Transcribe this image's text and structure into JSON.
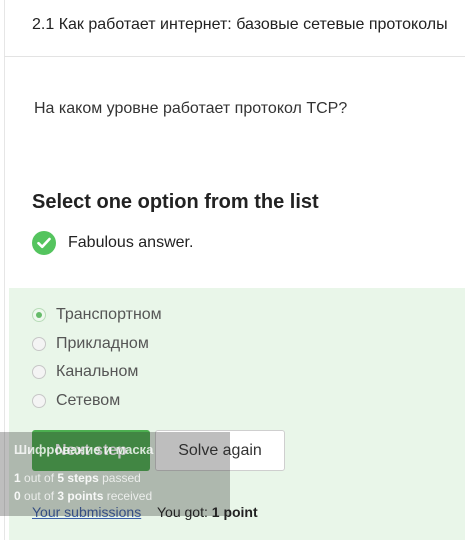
{
  "lesson": {
    "title": "2.1 Как работает интернет: базовые сетевые протоколы"
  },
  "question": {
    "text": "На каком уровне работает протокол TCP?"
  },
  "prompt": {
    "heading": "Select one option from the list"
  },
  "feedback": {
    "text": "Fabulous answer.",
    "icon": "check-circle-icon",
    "color": "#54c45e"
  },
  "options": [
    {
      "label": "Транспортном",
      "selected": true
    },
    {
      "label": "Прикладном",
      "selected": false
    },
    {
      "label": "Канальном",
      "selected": false
    },
    {
      "label": "Сетевом",
      "selected": false
    }
  ],
  "actions": {
    "next_label": "Next step",
    "solve_again_label": "Solve again"
  },
  "footer": {
    "submissions_label": "Your submissions",
    "score_prefix": "You got:",
    "score_value": "1 point"
  },
  "progress": {
    "title": "Шифрование и маска",
    "steps_count": "1",
    "steps_mid": "out of",
    "steps_total": "5 steps",
    "steps_suffix": "passed",
    "points_count": "0",
    "points_mid": "out of",
    "points_total": "3 points",
    "points_suffix": "received"
  },
  "colors": {
    "accent": "#4caf50",
    "panel": "#e9f6e9",
    "link": "#3a5ea8"
  }
}
